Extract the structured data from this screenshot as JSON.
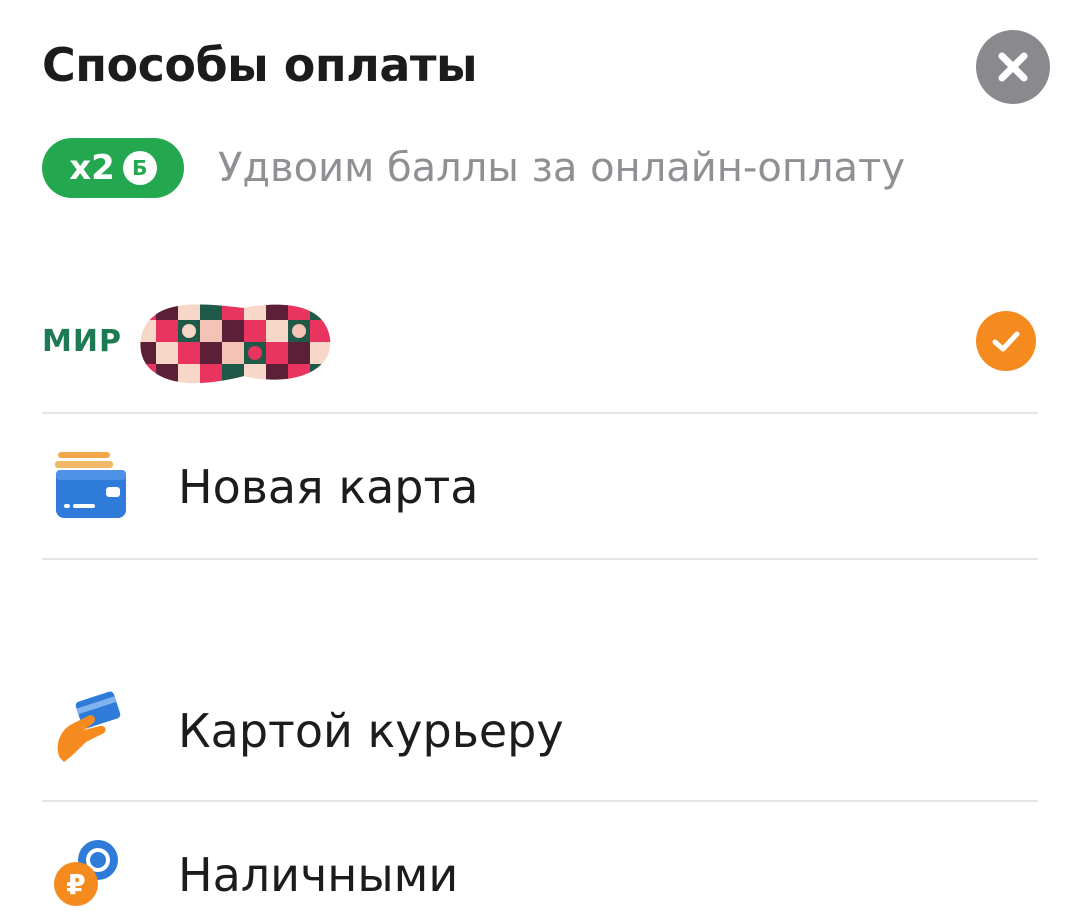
{
  "sheet": {
    "title": "Способы оплаты",
    "close_icon": "close-icon"
  },
  "promo": {
    "multiplier": "x2",
    "coin_symbol": "Б",
    "text": "Удвоим баллы за онлайн-оплату",
    "badge_color": "#23a84f"
  },
  "payment_methods": [
    {
      "brand": "МИР",
      "masked": true,
      "selected": true,
      "check_color": "#f58b1f"
    },
    {
      "label": "Новая карта",
      "icon": "new-card-icon"
    },
    {
      "label": "Картой курьеру",
      "icon": "card-to-courier-icon"
    },
    {
      "label": "Наличными",
      "icon": "cash-coins-icon"
    }
  ]
}
